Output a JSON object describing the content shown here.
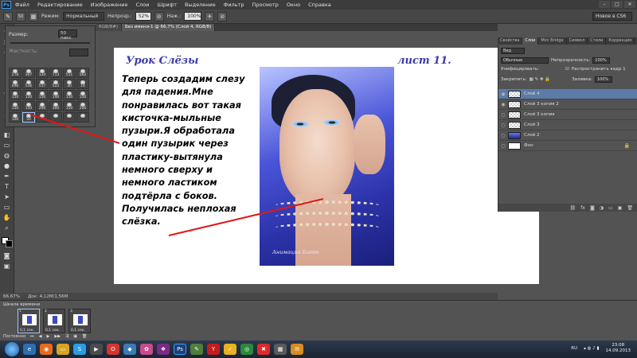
{
  "menubar": {
    "logo": "Ps",
    "items": [
      "Файл",
      "Редактирование",
      "Изображение",
      "Слои",
      "Шрифт",
      "Выделение",
      "Фильтр",
      "Просмотр",
      "Окно",
      "Справка"
    ]
  },
  "options": {
    "mode_label": "Режим:",
    "mode_value": "Нормальный",
    "opacity_label": "Непрозр.:",
    "opacity_value": "52%",
    "flow_label": "Наж.:",
    "flow_value": "100%",
    "brush_size": "50",
    "workspace": "Новое в CS6"
  },
  "brush_panel": {
    "size_label": "Размер:",
    "size_value": "50 пикс.",
    "hardness_label": "Жесткость:",
    "brushes": [
      "278",
      "307",
      "120",
      "713",
      "511",
      "562",
      "496",
      "536",
      "517",
      "522",
      "30",
      "14",
      "150",
      "120",
      "150",
      "140",
      "150",
      "150",
      "150",
      "150",
      "200",
      "300",
      "150",
      "200",
      "100",
      "50",
      "",
      "",
      "",
      ""
    ]
  },
  "doc_tabs": {
    "tab1": "RGB/8#)",
    "tab2": "Без имени-1 @ 66,7% (Слой 4, RGB/8)"
  },
  "canvas": {
    "title": "Урок Слёзы",
    "sheet": "лист 11.",
    "text": "Теперь создадим слезу\nдля падения.Мне\nпонравилась вот такая\nкисточка-мыльные\nпузыри.Я обработала\nодин пузырик через\nпластику-вытянула\nнемного сверху и\nнемного ластиком\nподтёрла с боков.\nПолучилась неплохая\nслёзка.",
    "signature": "Анимация Бэтт"
  },
  "right_panel": {
    "tabs": [
      "Свойства",
      "Слои",
      "Mini Bridge",
      "Символ",
      "Стили",
      "Коррекция"
    ],
    "search_placeholder": "Вид",
    "blend_mode": "Обычные",
    "opacity_label": "Непрозрачность:",
    "opacity_value": "100%",
    "unify_label": "Унифицировать:",
    "propagate_label": "Распространить кадр 1",
    "lock_label": "Закрепить:",
    "fill_label": "Заливка:",
    "fill_value": "100%",
    "layers": [
      {
        "name": "Слой 4",
        "thumb": "trans",
        "active": true,
        "visible": true
      },
      {
        "name": "Слой 3 копия 2",
        "thumb": "trans",
        "active": false,
        "visible": true
      },
      {
        "name": "Слой 3 копия",
        "thumb": "trans",
        "active": false,
        "visible": false
      },
      {
        "name": "Слой 3",
        "thumb": "trans",
        "active": false,
        "visible": false
      },
      {
        "name": "Слой 2",
        "thumb": "photo",
        "active": false,
        "visible": false
      },
      {
        "name": "Фон",
        "thumb": "white",
        "active": false,
        "visible": false,
        "locked": true
      }
    ]
  },
  "status": {
    "zoom": "66,67%",
    "doc": "Док: 4,12M/1,56M"
  },
  "timeline": {
    "title": "Шкала времени",
    "frames": [
      {
        "num": "1",
        "delay": "0,1 сек.",
        "selected": true
      },
      {
        "num": "2",
        "delay": "0,1 сек.",
        "selected": false
      },
      {
        "num": "3",
        "delay": "0,1 сек.",
        "selected": false
      }
    ],
    "loop": "Постоянно"
  },
  "taskbar": {
    "lang": "RU",
    "time": "23:08",
    "date": "14.09.2013"
  },
  "colors": {
    "title_blue": "#3a3aaa",
    "annotation_red": "#e01818",
    "active_layer": "#5b7ba8"
  }
}
